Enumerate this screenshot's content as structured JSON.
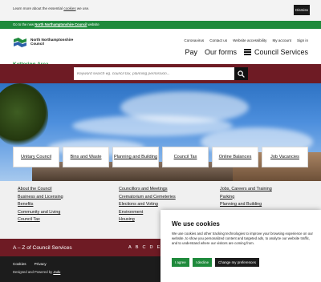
{
  "cookie_notice": {
    "message_prefix": "Learn more about the essential",
    "message_link": "cookies",
    "message_suffix": "we use.",
    "dismiss_label": "Dismiss"
  },
  "site_banner": {
    "prefix": "Go to the new",
    "link": "North Northamptonshire Council",
    "suffix": "website"
  },
  "header": {
    "council_name": "North Northamptonshire Council",
    "area_name": "Kettering Area",
    "utility_links": [
      "Coronavirus",
      "Contact us",
      "Website accessibility",
      "My account",
      "Sign in"
    ],
    "main_nav": {
      "pay": "Pay",
      "forms": "Our forms",
      "services": "Council Services"
    }
  },
  "search": {
    "placeholder": "Keyword search eg. council tax, planning permission..."
  },
  "quick_links": [
    "Unitary Council",
    "Bins and Waste",
    "Planning and Building",
    "Council Tax",
    "Online Balances",
    "Job Vacancies"
  ],
  "link_columns": [
    [
      "About the Council",
      "Business and Licensing",
      "Benefits",
      "Community and Living",
      "Council Tax"
    ],
    [
      "Councillors and Meetings",
      "Crematorium and Cemeteries",
      "Elections and Voting",
      "Environment",
      "Housing"
    ],
    [
      "Jobs, Careers and Training",
      "Parking",
      "Planning and Building"
    ]
  ],
  "az": {
    "title": "A – Z of Council Services",
    "letters": [
      "A",
      "B",
      "C",
      "D",
      "E"
    ]
  },
  "footer": {
    "links": [
      "Cookies",
      "Privacy"
    ],
    "credit_prefix": "Designed and Powered by",
    "credit_link": "Jadu"
  },
  "cookie_modal": {
    "title": "We use cookies",
    "body": "We use cookies and other tracking technologies to improve your browsing experience on our website, to show you personalized content and targeted ads, to analyze our website traffic, and to understand where our visitors are coming from.",
    "agree_label": "I agree",
    "decline_label": "I decline",
    "preferences_label": "Change my preferences"
  },
  "colors": {
    "brand_green": "#1f8a3c",
    "brand_maroon": "#6e1b24"
  }
}
